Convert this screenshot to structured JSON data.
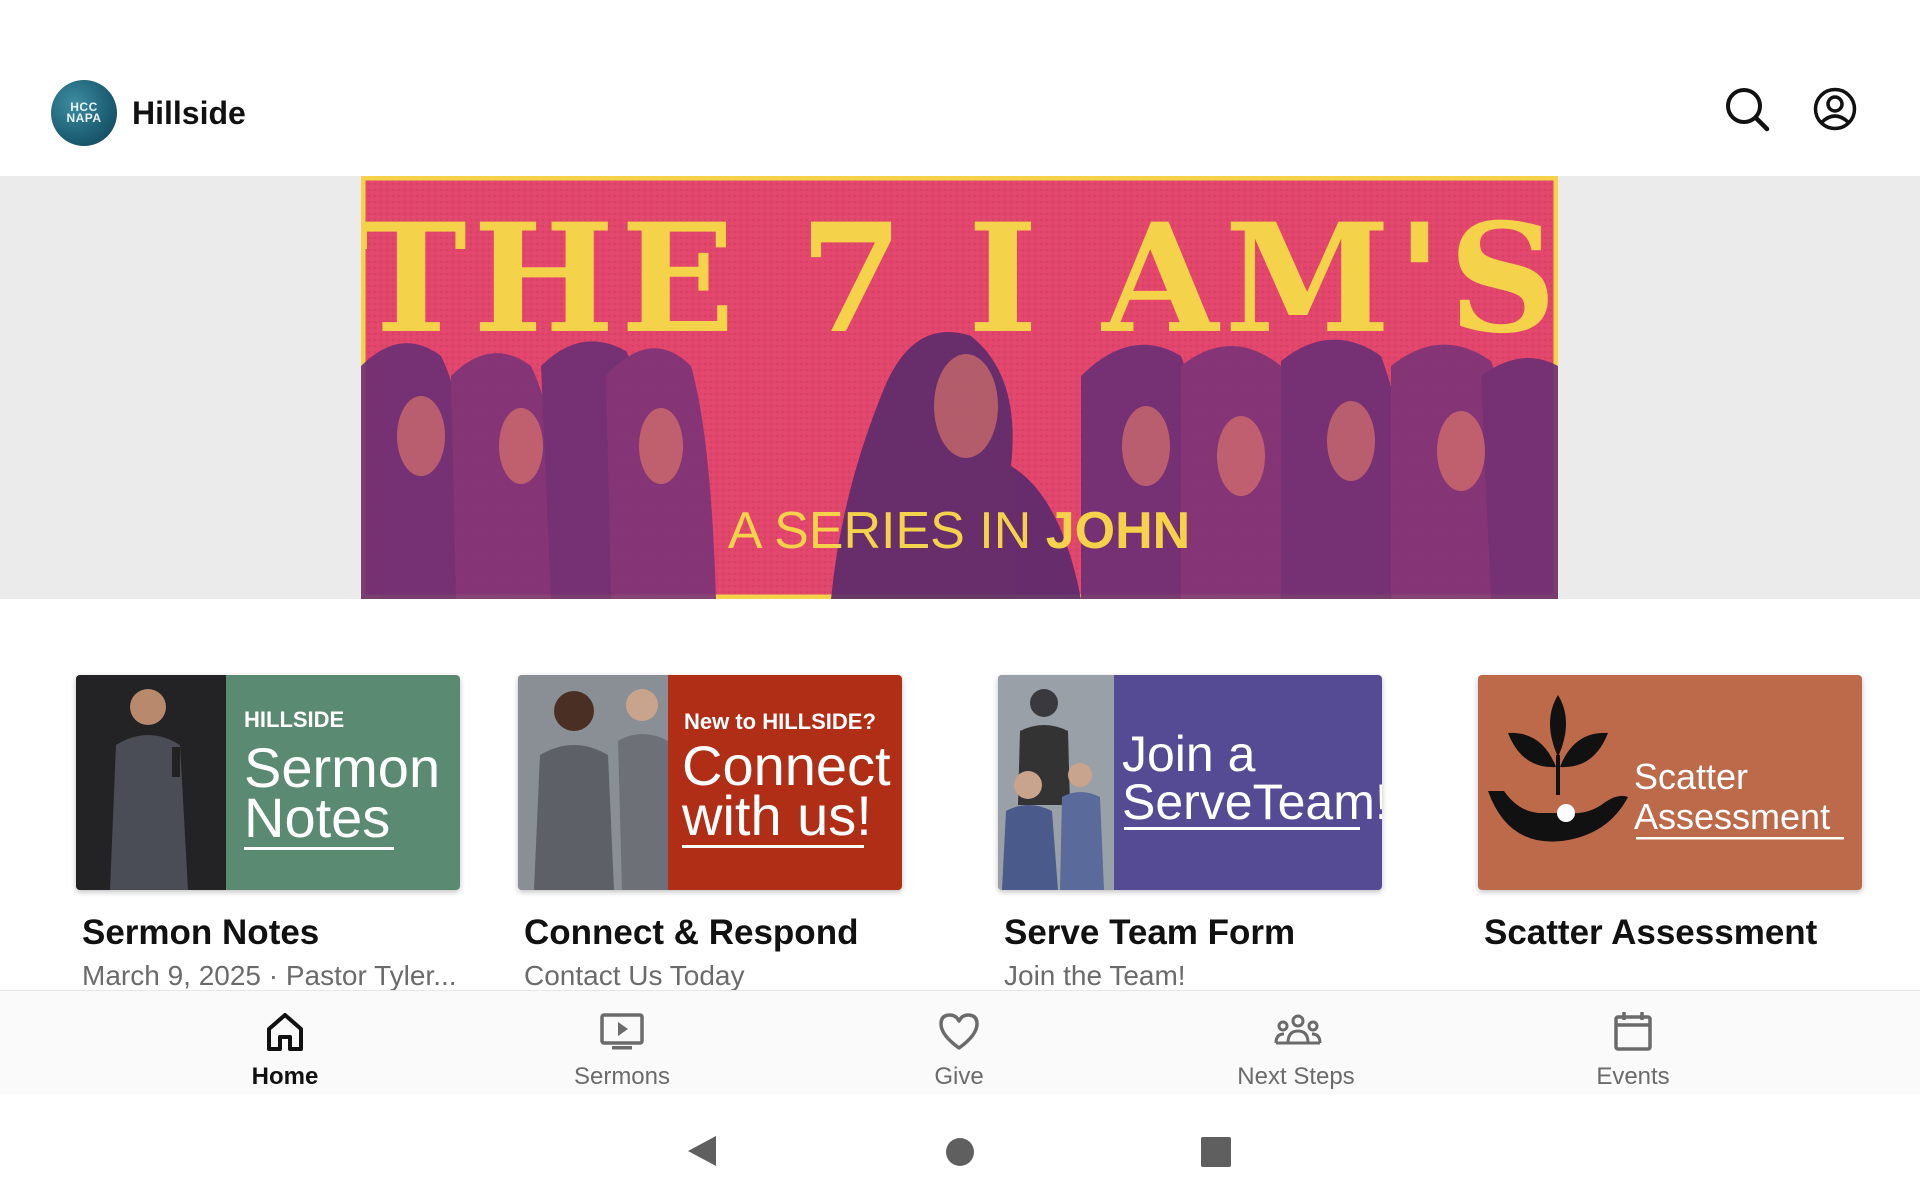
{
  "header": {
    "app_name": "Hillside",
    "logo_text_line1": "HCC",
    "logo_text_line2": "NAPA",
    "search_icon": "search-icon",
    "profile_icon": "account-circle-icon"
  },
  "banner": {
    "headline": "THE 7 I AM'S",
    "subline_prefix": "A SERIES IN ",
    "subline_bold": "JOHN"
  },
  "cards": [
    {
      "title": "Sermon Notes",
      "subtitle": "March 9, 2025 · Pastor Tyler...",
      "thumb_small": "HILLSIDE",
      "thumb_line1": "Sermon",
      "thumb_line2": "Notes",
      "color": "#5b8a72"
    },
    {
      "title": "Connect & Respond",
      "subtitle": "Contact Us Today",
      "thumb_small": "New to HILLSIDE?",
      "thumb_line1": "Connect",
      "thumb_line2": "with us!",
      "color": "#b02e16"
    },
    {
      "title": "Serve Team Form",
      "subtitle": "Join the Team!",
      "thumb_line1": "Join a",
      "thumb_line2": "ServeTeam!",
      "color": "#554a94"
    },
    {
      "title": "Scatter Assessment",
      "subtitle": "",
      "thumb_line1": "Scatter",
      "thumb_line2": "Assessment",
      "color": "#bd6a4b"
    }
  ],
  "bottom_nav": [
    {
      "label": "Home",
      "icon": "home-icon",
      "active": true
    },
    {
      "label": "Sermons",
      "icon": "video-play-icon",
      "active": false
    },
    {
      "label": "Give",
      "icon": "heart-icon",
      "active": false
    },
    {
      "label": "Next Steps",
      "icon": "groups-icon",
      "active": false
    },
    {
      "label": "Events",
      "icon": "calendar-icon",
      "active": false
    }
  ],
  "colors": {
    "banner_pink": "#e0456a",
    "banner_yellow": "#f4d24a",
    "banner_purple": "#5d2c73"
  }
}
